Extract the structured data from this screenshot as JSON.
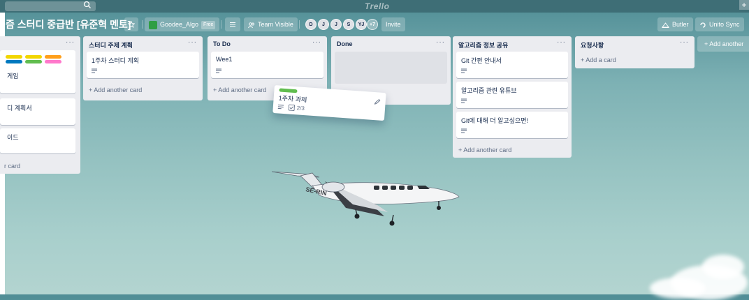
{
  "topbar": {
    "logo": "Trello",
    "plus": "+"
  },
  "board": {
    "title": "즘 스터디 중급반 [유준혁 멘토]",
    "workspace_label": "Goodee_Algo",
    "workspace_badge": "Free",
    "visibility_label": "Team Visible",
    "members": [
      "D",
      "J",
      "J",
      "S",
      "YJ"
    ],
    "more_members": "+7",
    "invite_label": "Invite",
    "butler_label": "Butler",
    "unito_label": "Unito Sync"
  },
  "lists": [
    {
      "name": "",
      "cards": [
        "게임",
        "디 계획서",
        "이드"
      ],
      "add_label": "r card"
    },
    {
      "name": "스터디 주제 계획",
      "cards": [
        "1주차 스터디 계획"
      ],
      "add_label": "Add another card"
    },
    {
      "name": "To Do",
      "cards": [
        "Wee1"
      ],
      "add_label": "Add another card"
    },
    {
      "name": "Done",
      "cards": [],
      "add_label": ""
    },
    {
      "name": "알고리즘 정보 공유",
      "cards": [
        "Git 간편 안내서",
        "알고리즘 관련 유튜브",
        "Git에 대해 더 알고싶으면!"
      ],
      "add_label": "Add another card"
    },
    {
      "name": "요청사항",
      "cards": [],
      "add_label": "Add a card"
    }
  ],
  "dragging_card": {
    "title": "1주차 과제",
    "checklist": "2/3",
    "label_color": "#61bd4f"
  },
  "add_list_label": "Add another",
  "plane_registration": "SE-RIN",
  "colors": {
    "label_yellow": "#f2d600",
    "label_orange": "#ff9f1a",
    "label_blue": "#0079bf",
    "label_green": "#61bd4f",
    "label_pink": "#ff78cb"
  }
}
